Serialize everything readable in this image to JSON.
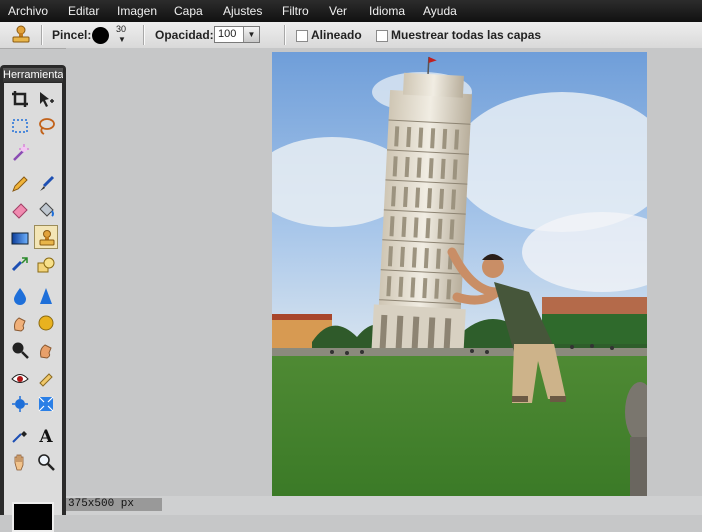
{
  "menu": [
    "Archivo",
    "Editar",
    "Imagen",
    "Capa",
    "Ajustes",
    "Filtro",
    "Ver",
    "Idioma",
    "Ayuda"
  ],
  "options": {
    "tool_icon": "clone-stamp-icon",
    "brush_label": "Pincel:",
    "brush_size": "30",
    "opacity_label": "Opacidad:",
    "opacity_value": "100",
    "aligned_label": "Alineado",
    "sample_all_label": "Muestrear todas las capas"
  },
  "toolbox": {
    "title": "Herramientas",
    "tools": [
      "crop-icon",
      "move-icon",
      "marquee-icon",
      "lasso-icon",
      "magic-wand-icon",
      "pencil-icon",
      "brush-icon",
      "eraser-icon",
      "bucket-icon",
      "gradient-icon",
      "clone-stamp-icon",
      "color-replace-icon",
      "shape-icon",
      "blur-icon",
      "sharpen-icon",
      "smudge-icon",
      "sponge-icon",
      "dodge-icon",
      "burn-icon",
      "red-eye-icon",
      "spot-heal-icon",
      "bloat-icon",
      "pinch-icon",
      "eyedropper-icon",
      "text-icon",
      "hand-icon",
      "zoom-icon"
    ],
    "active_tool": "clone-stamp-icon",
    "foreground_color": "#000000"
  },
  "status": {
    "dimensions": "375x500 px"
  }
}
